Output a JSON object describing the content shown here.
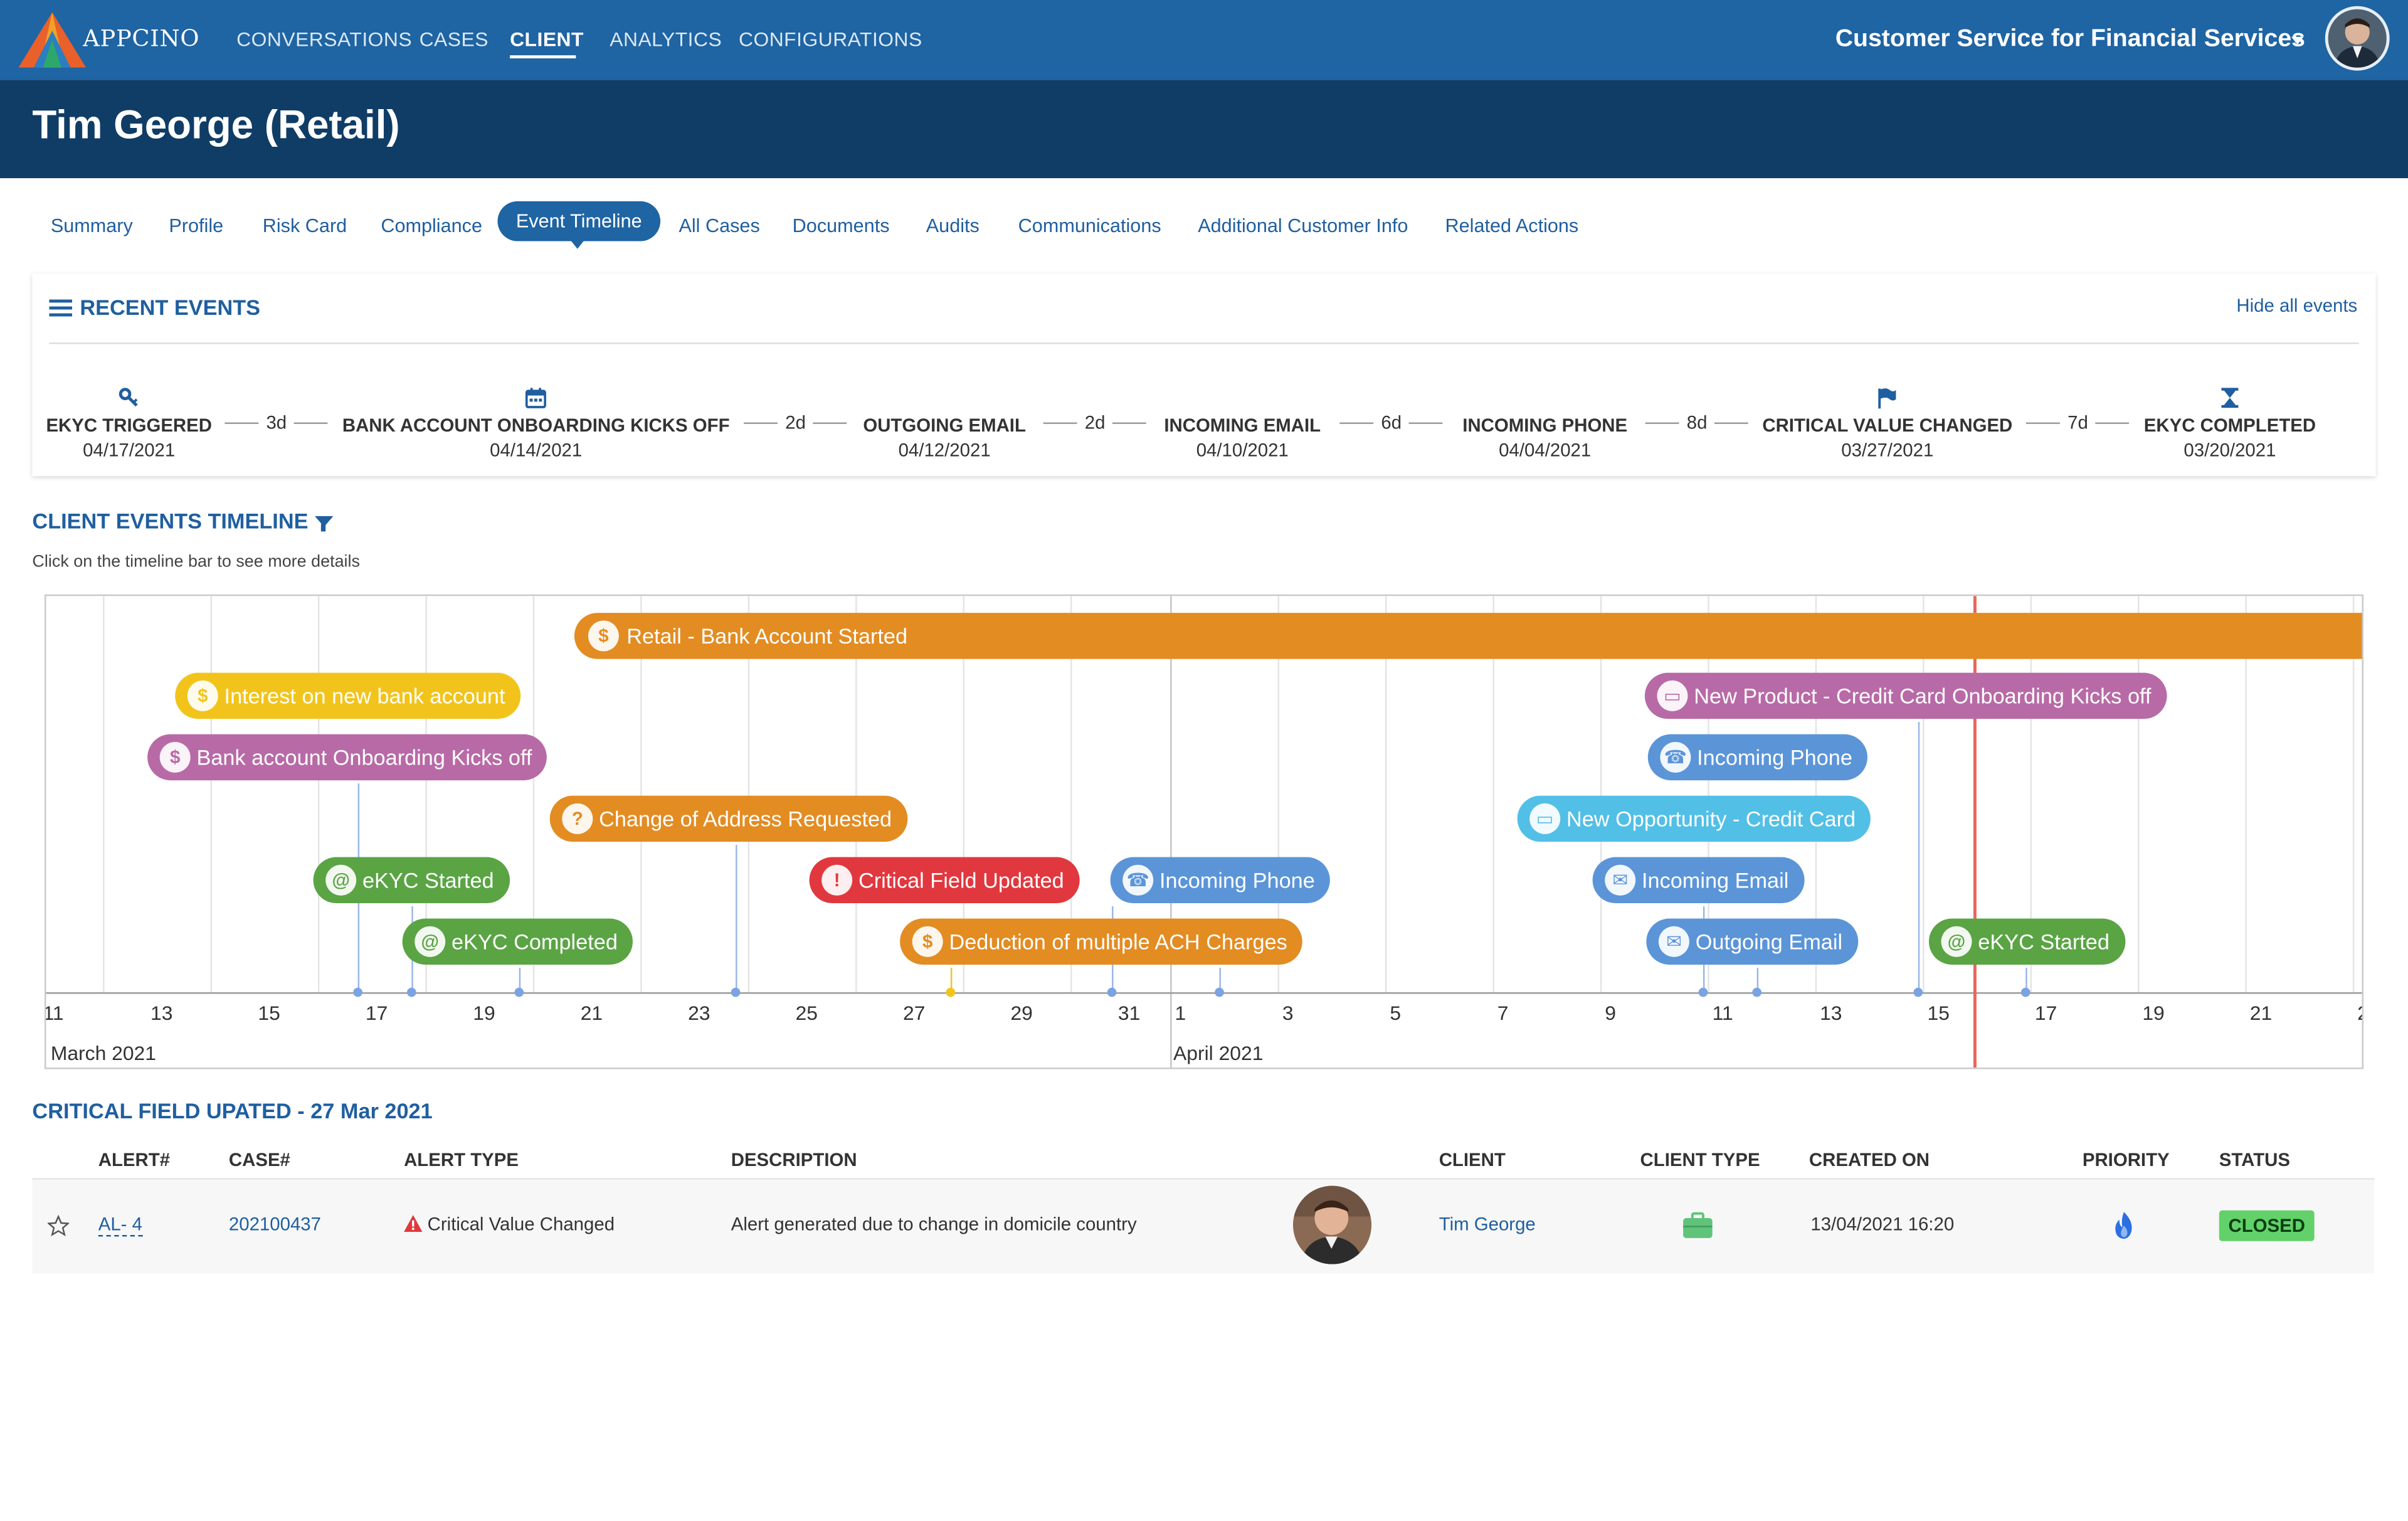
{
  "header": {
    "logo_text": "APPCINO",
    "nav": [
      "CONVERSATIONS",
      "CASES",
      "CLIENT",
      "ANALYTICS",
      "CONFIGURATIONS"
    ],
    "active_nav": "CLIENT",
    "app_title": "Customer Service for Financial Services",
    "icons": {
      "caret": "chevron-down-icon",
      "avatar": "user-avatar"
    }
  },
  "page": {
    "title": "Tim George (Retail)"
  },
  "tabs": [
    "Summary",
    "Profile",
    "Risk Card",
    "Compliance",
    "Event Timeline",
    "All Cases",
    "Documents",
    "Audits",
    "Communications",
    "Additional Customer Info",
    "Related Actions"
  ],
  "active_tab": "Event Timeline",
  "recent": {
    "title": "RECENT EVENTS",
    "hide_label": "Hide all events",
    "events": [
      {
        "icon": "key-icon",
        "name": "EKYC TRIGGERED",
        "date": "04/17/2021"
      },
      {
        "icon": "calendar-icon",
        "name": "BANK ACCOUNT ONBOARDING KICKS OFF",
        "date": "04/14/2021"
      },
      {
        "icon": "",
        "name": "OUTGOING EMAIL",
        "date": "04/12/2021"
      },
      {
        "icon": "",
        "name": "INCOMING EMAIL",
        "date": "04/10/2021"
      },
      {
        "icon": "",
        "name": "INCOMING PHONE",
        "date": "04/04/2021"
      },
      {
        "icon": "flag-icon",
        "name": "CRITICAL VALUE CHANGED",
        "date": "03/27/2021"
      },
      {
        "icon": "hourglass-icon",
        "name": "EKYC COMPLETED",
        "date": "03/20/2021"
      }
    ],
    "gaps": [
      "3d",
      "2d",
      "2d",
      "6d",
      "8d",
      "7d"
    ]
  },
  "timeline": {
    "title": "CLIENT EVENTS TIMELINE",
    "hint": "Click on the timeline bar to see more details",
    "ticks": [
      "11",
      "13",
      "15",
      "17",
      "19",
      "21",
      "23",
      "25",
      "27",
      "29",
      "31",
      "1",
      "3",
      "5",
      "7",
      "9",
      "11",
      "13",
      "15",
      "17",
      "19",
      "21",
      "2"
    ],
    "months": [
      "March 2021",
      "April 2021"
    ],
    "main_bar": "Retail - Bank Account Started",
    "pills": [
      {
        "label": "Interest on new bank account",
        "icon": "dollar-icon"
      },
      {
        "label": "Bank account Onboarding Kicks off",
        "icon": "piggy-bank-icon"
      },
      {
        "label": "Change of Address Requested",
        "icon": "address-change-icon"
      },
      {
        "label": "eKYC Started",
        "icon": "fingerprint-icon"
      },
      {
        "label": "eKYC Completed",
        "icon": "fingerprint-icon"
      },
      {
        "label": "Critical Field Updated",
        "icon": "warning-icon"
      },
      {
        "label": "Deduction of multiple ACH Charges",
        "icon": "dollar-icon"
      },
      {
        "label": "Incoming Phone",
        "icon": "phone-icon"
      },
      {
        "label": "New Product - Credit Card Onboarding Kicks off",
        "icon": "credit-card-icon"
      },
      {
        "label": "Incoming Phone",
        "icon": "phone-icon"
      },
      {
        "label": "New Opportunity - Credit Card",
        "icon": "credit-card-icon"
      },
      {
        "label": "Incoming Email",
        "icon": "envelope-icon"
      },
      {
        "label": "Outgoing Email",
        "icon": "envelope-icon"
      },
      {
        "label": "eKYC Started",
        "icon": "fingerprint-icon"
      }
    ]
  },
  "alerts": {
    "title": "CRITICAL FIELD UPATED - 27 Mar 2021",
    "columns": [
      "ALERT#",
      "CASE#",
      "ALERT TYPE",
      "DESCRIPTION",
      "CLIENT",
      "CLIENT TYPE",
      "CREATED ON",
      "PRIORITY",
      "STATUS"
    ],
    "rows": [
      {
        "alert": "AL- 4",
        "case": "202100437",
        "type": "Critical Value Changed",
        "description": "Alert generated due to change in domicile country",
        "client": "Tim George",
        "client_type_icon": "briefcase-icon",
        "created": "13/04/2021 16:20",
        "priority_icon": "flame-icon",
        "status": "CLOSED"
      }
    ]
  },
  "colors": {
    "primary": "#1f64a3",
    "dark": "#0f3d66",
    "orange": "#e38c22",
    "yellow": "#f2c41b",
    "purple": "#b86aa6",
    "green": "#5aa444",
    "red": "#e0383e",
    "blue": "#5b95d8",
    "lightblue": "#52bfe6",
    "closed": "#62d16a",
    "now_line": "#e8665a"
  }
}
